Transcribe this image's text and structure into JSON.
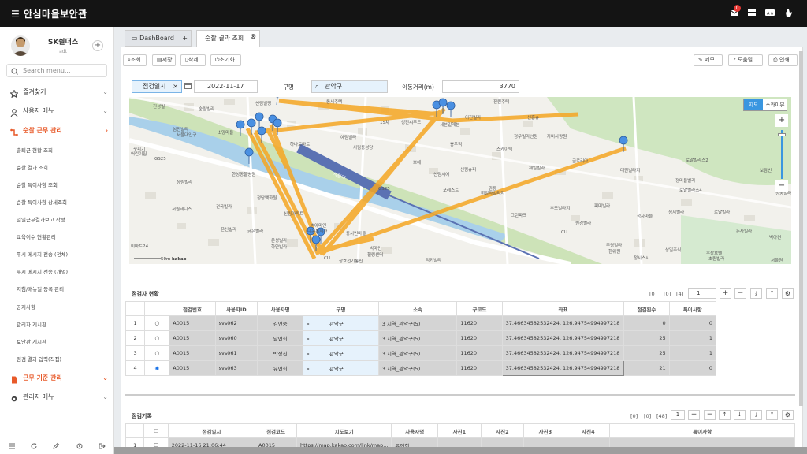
{
  "app": {
    "title": "안심마을보안관",
    "notification_count": "0"
  },
  "user": {
    "name": "SK쉴더스",
    "id": "adt"
  },
  "sidebar": {
    "search_placeholder": "Search menu...",
    "menus": [
      {
        "label": "즐겨찾기"
      },
      {
        "label": "사용자 메뉴"
      },
      {
        "label": "순찰 근무 관리"
      }
    ],
    "submenu": [
      "출퇴근 현황 조회",
      "순찰 결과 조회",
      "순찰 특이사항 조회",
      "순찰 특이사항 상세조회",
      "일일근무결과보고 작성",
      "교육이수 현황관리",
      "푸시 메시지 전송 (전체)",
      "푸시 메시지 전송 (개별)",
      "지침/매뉴얼 등록 관리",
      "공지사항",
      "관리자 게시판",
      "보안관 게시판",
      "점검 결과 입력(직접)"
    ],
    "menus2": [
      {
        "label": "근무 기준 관리"
      },
      {
        "label": "관리자 메뉴"
      }
    ]
  },
  "tabs": [
    {
      "label": "DashBoard"
    },
    {
      "label": "순찰 결과 조회"
    }
  ],
  "toolbar": {
    "search": "조회",
    "save": "저장",
    "delete": "삭제",
    "reset": "초기화",
    "memo": "메모",
    "help": "도움말",
    "print": "인쇄"
  },
  "filters": {
    "date_label": "점검일시",
    "date_value": "2022-11-17",
    "district_label": "구명",
    "district_value": "관악구",
    "distance_label": "이동거리(m)",
    "distance_value": "3770"
  },
  "map": {
    "view_map": "지도",
    "view_skyview": "스카이뷰",
    "scale": "50m",
    "logo": "kakao",
    "labels": [
      "신림빌딩",
      "동서주택",
      "전원주택",
      "진성빌",
      "숭림빌라",
      "15차",
      "성진씨푸드",
      "어진빌라",
      "신흥슈",
      "섬진빌라",
      "현대아파트",
      "예림빌라",
      "세븐일레븐",
      "하나로마트",
      "서림동성당",
      "봉우적",
      "푸마소",
      "스카이텍",
      "정우빌라선원",
      "자비사랑원",
      "보해",
      "신림슈퍼",
      "체일빌라",
      "글로리아",
      "대원빌라지",
      "로얄빌라스2",
      "보람빈",
      "포레스트",
      "관동",
      "히얼라빌라지",
      "정마을빌라",
      "로얄빌라스4",
      "상림빌라",
      "로얄빌라",
      "건국빌라",
      "성정백화원",
      "그린파크",
      "부모빌라지",
      "정자마을",
      "정지빌라",
      "원경빌라",
      "돈사빌라",
      "퍼미빌라",
      "은신빌라",
      "금은빌라",
      "신림아파트",
      "동서빈마을",
      "벽아컨",
      "은성빌라",
      "하얀빌라",
      "하이트빌라",
      "복대빌라",
      "주영빌라",
      "전원빌라",
      "한영빌라",
      "심사스시",
      "초원빌라",
      "상호전기통신",
      "럭키빌라",
      "세신빌라",
      "서림역",
      "관악구",
      "씨에스",
      "로얄빌라스",
      "버스",
      "이마트24",
      "GS25",
      "CU",
      "서울대입구",
      "신정동성역",
      "꾸피기",
      "어린이집",
      "소망마을",
      "미림빌라",
      "성산빌라",
      "대성빌라"
    ]
  },
  "table1": {
    "title": "점검자 현황",
    "counts": [
      "[0]",
      "[0]",
      "[4]"
    ],
    "page": "1",
    "headers": [
      "점검번호",
      "사용자ID",
      "사용자명",
      "구명",
      "소속",
      "구코드",
      "좌표",
      "점검횟수",
      "특이사항"
    ],
    "rows": [
      {
        "no": "1",
        "code": "A0015",
        "uid": "svs062",
        "name": "김연중",
        "district": "관악구",
        "org": "3 지역_관악구(5)",
        "gcode": "11620",
        "coord": "37.46634582532424, 126.94754994997218",
        "count": "0",
        "special": "0",
        "selected": false
      },
      {
        "no": "2",
        "code": "A0015",
        "uid": "svs060",
        "name": "남연희",
        "district": "관악구",
        "org": "3 지역_관악구(5)",
        "gcode": "11620",
        "coord": "37.46634582532424, 126.94754994997218",
        "count": "25",
        "special": "1",
        "selected": false
      },
      {
        "no": "3",
        "code": "A0015",
        "uid": "svs061",
        "name": "박성진",
        "district": "관악구",
        "org": "3 지역_관악구(5)",
        "gcode": "11620",
        "coord": "37.46634582532424, 126.94754994997218",
        "count": "25",
        "special": "1",
        "selected": false
      },
      {
        "no": "4",
        "code": "A0015",
        "uid": "svs063",
        "name": "유연희",
        "district": "관악구",
        "org": "3 지역_관악구(5)",
        "gcode": "11620",
        "coord": "37.46634582532424, 126.94754994997218",
        "count": "21",
        "special": "0",
        "selected": true
      }
    ]
  },
  "table2": {
    "title": "점검기록",
    "counts": [
      "[0]",
      "[0]",
      "[48]"
    ],
    "page": "1",
    "headers": [
      "점검일시",
      "점검코드",
      "지도보기",
      "사용자명",
      "사진1",
      "사진2",
      "사진3",
      "사진4",
      "특이사항"
    ],
    "rows": [
      {
        "no": "1",
        "date": "2022-11-16 21:06:44",
        "code": "A0015",
        "map": "https://map.kakao.com/link/map...",
        "name": "유연희"
      }
    ]
  }
}
